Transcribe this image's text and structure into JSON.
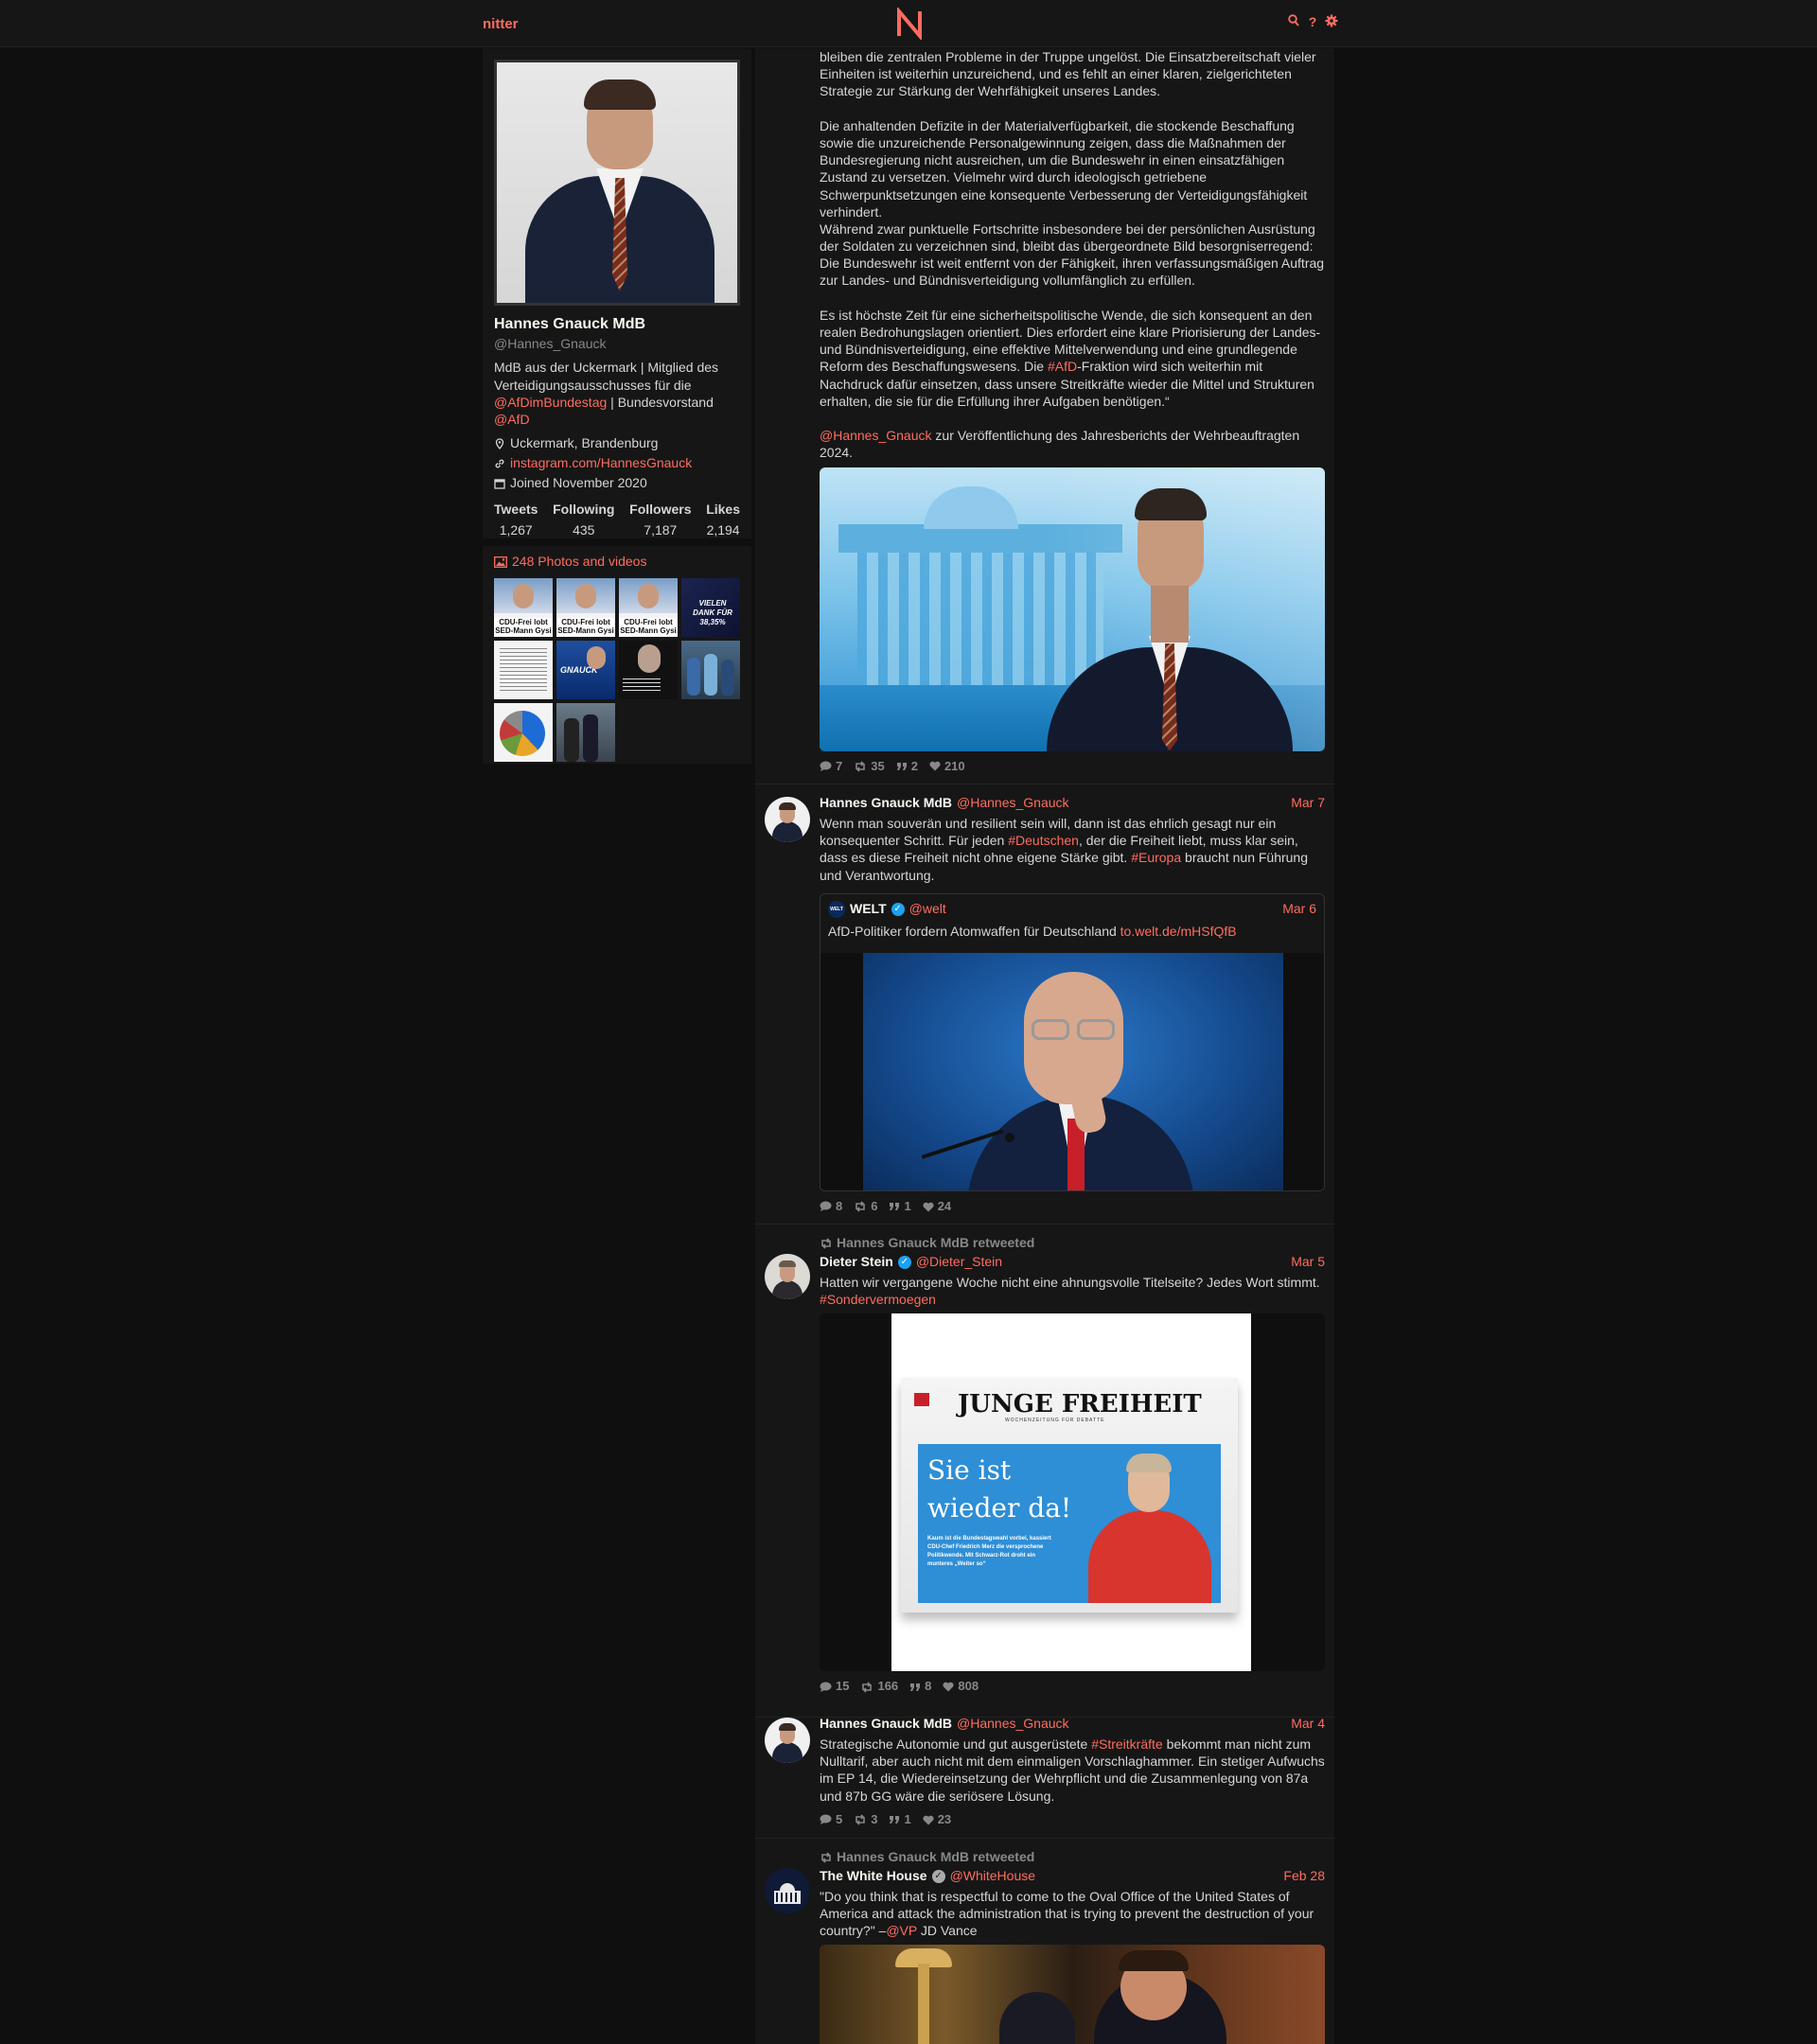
{
  "nav": {
    "brand": "nitter",
    "icons": [
      "search-icon",
      "help-icon",
      "settings-icon"
    ],
    "accent": "#ff6c60"
  },
  "profile": {
    "name": "Hannes Gnauck MdB",
    "handle": "@Hannes_Gnauck",
    "bio_pre": "MdB aus der Uckermark | Mitglied des Verteidigungsausschusses für die ",
    "bio_link1": "@AfDimBundestag",
    "bio_mid": " | Bundesvorstand ",
    "bio_link2": "@AfD",
    "location": "Uckermark, Brandenburg",
    "website": "instagram.com/HannesGnauck",
    "joined": "Joined November 2020",
    "stats": [
      {
        "label": "Tweets",
        "value": "1,267"
      },
      {
        "label": "Following",
        "value": "435"
      },
      {
        "label": "Followers",
        "value": "7,187"
      },
      {
        "label": "Likes",
        "value": "2,194"
      }
    ]
  },
  "media": {
    "title": "248 Photos and videos",
    "thumb_caption": "CDU-Frei lobt SED-Mann Gysi",
    "thumb_caption_2": "VIELEN DANK FÜR 38,35%",
    "thumb_caption_3": "GNAUCK"
  },
  "tweets": [
    {
      "text_p1": "bleiben die zentralen Probleme in der Truppe ungelöst. Die Einsatzbereitschaft vieler Einheiten ist weiterhin unzureichend, und es fehlt an einer klaren, zielgerichteten Strategie zur Stärkung der Wehrfähigkeit unseres Landes.",
      "text_p2": "Die anhaltenden Defizite in der Materialverfügbarkeit, die stockende Beschaffung sowie die unzureichende Personalgewinnung zeigen, dass die Maßnahmen der Bundesregierung nicht ausreichen, um die Bundeswehr in einen einsatzfähigen Zustand zu versetzen. Vielmehr wird durch ideologisch getriebene Schwerpunktsetzungen eine konsequente Verbesserung der Verteidigungsfähigkeit verhindert.",
      "text_p3": "Während zwar punktuelle Fortschritte insbesondere bei der persönlichen Ausrüstung der Soldaten zu verzeichnen sind, bleibt das übergeordnete Bild besorgniserregend: Die Bundeswehr ist weit entfernt von der Fähigkeit, ihren verfassungsmäßigen Auftrag zur Landes- und Bündnisverteidigung vollumfänglich zu erfüllen.",
      "text_p4_pre": "Es ist höchste Zeit für eine sicherheitspolitische Wende, die sich konsequent an den realen Bedrohungslagen orientiert. Dies erfordert eine klare Priorisierung der Landes- und Bündnisverteidigung, eine effektive Mittelverwendung und eine grundlegende Reform des Beschaffungswesens. Die ",
      "text_p4_tag": "#AfD",
      "text_p4_post": "-Fraktion wird sich weiterhin mit Nachdruck dafür einsetzen, dass unsere Streitkräfte wieder die Mittel und Strukturen erhalten, die sie für die Erfüllung ihrer Aufgaben benötigen.“",
      "text_p5_link": "@Hannes_Gnauck",
      "text_p5_post": " zur Veröffentlichung des Jahresberichts der Wehrbeauftragten 2024.",
      "stats": {
        "replies": "7",
        "retweets": "35",
        "quotes": "2",
        "likes": "210"
      }
    },
    {
      "name": "Hannes Gnauck MdB",
      "user": "@Hannes_Gnauck",
      "date": "Mar 7",
      "text_a": "Wenn man souverän und resilient sein will, dann ist das ehrlich gesagt nur ein konsequenter Schritt. Für jeden ",
      "tag1": "#Deutschen",
      "text_b": ", der die Freiheit liebt, muss klar sein, dass es diese Freiheit nicht ohne eigene Stärke gibt. ",
      "tag2": "#Europa",
      "text_c": " braucht nun Führung und Verantwortung.",
      "quote": {
        "logo": "WELT",
        "name": "WELT",
        "user": "@welt",
        "date": "Mar 6",
        "text": "AfD-Politiker fordern Atomwaffen für Deutschland ",
        "link": "to.welt.de/mHSfQfB"
      },
      "stats": {
        "replies": "8",
        "retweets": "6",
        "quotes": "1",
        "likes": "24"
      }
    },
    {
      "retweet_by": "Hannes Gnauck MdB retweeted",
      "name": "Dieter Stein",
      "user": "@Dieter_Stein",
      "date": "Mar 5",
      "text": "Hatten wir vergangene Woche nicht eine ahnungsvolle Titelseite? Jedes Wort stimmt. ",
      "tag": "#Sondervermoegen",
      "newspaper": {
        "masthead": "JUNGE FREIHEIT",
        "subtitle": "WOCHENZEITUNG FÜR DEBATTE",
        "headline_1": "Sie ist",
        "headline_2": "wieder da!",
        "blurb": "Kaum ist die Bundestagswahl vorbei, kassiert CDU-Chef Friedrich Merz die versprochene Politikwende. Mit Schwarz-Rot droht ein munteres „Weiter so“"
      },
      "stats": {
        "replies": "15",
        "retweets": "166",
        "quotes": "8",
        "likes": "808"
      }
    },
    {
      "name": "Hannes Gnauck MdB",
      "user": "@Hannes_Gnauck",
      "date": "Mar 4",
      "text_a": "Strategische Autonomie und gut ausgerüstete ",
      "tag": "#Streitkräfte",
      "text_b": " bekommt man nicht zum Nulltarif, aber auch nicht mit dem einmaligen Vorschlaghammer. Ein stetiger Aufwuchs im EP 14, die Wiedereinsetzung der Wehrpflicht und die Zusammenlegung von 87a und 87b GG wäre die seriösere Lösung.",
      "stats": {
        "replies": "5",
        "retweets": "3",
        "quotes": "1",
        "likes": "23"
      }
    },
    {
      "retweet_by": "Hannes Gnauck MdB retweeted",
      "name": "The White House",
      "user": "@WhiteHouse",
      "date": "Feb 28",
      "text_a": "\"Do you think that is respectful to come to the Oval Office of the United States of America and attack the administration that is trying to prevent the destruction of your country?\" –",
      "link": "@VP",
      "text_b": " JD Vance"
    }
  ]
}
